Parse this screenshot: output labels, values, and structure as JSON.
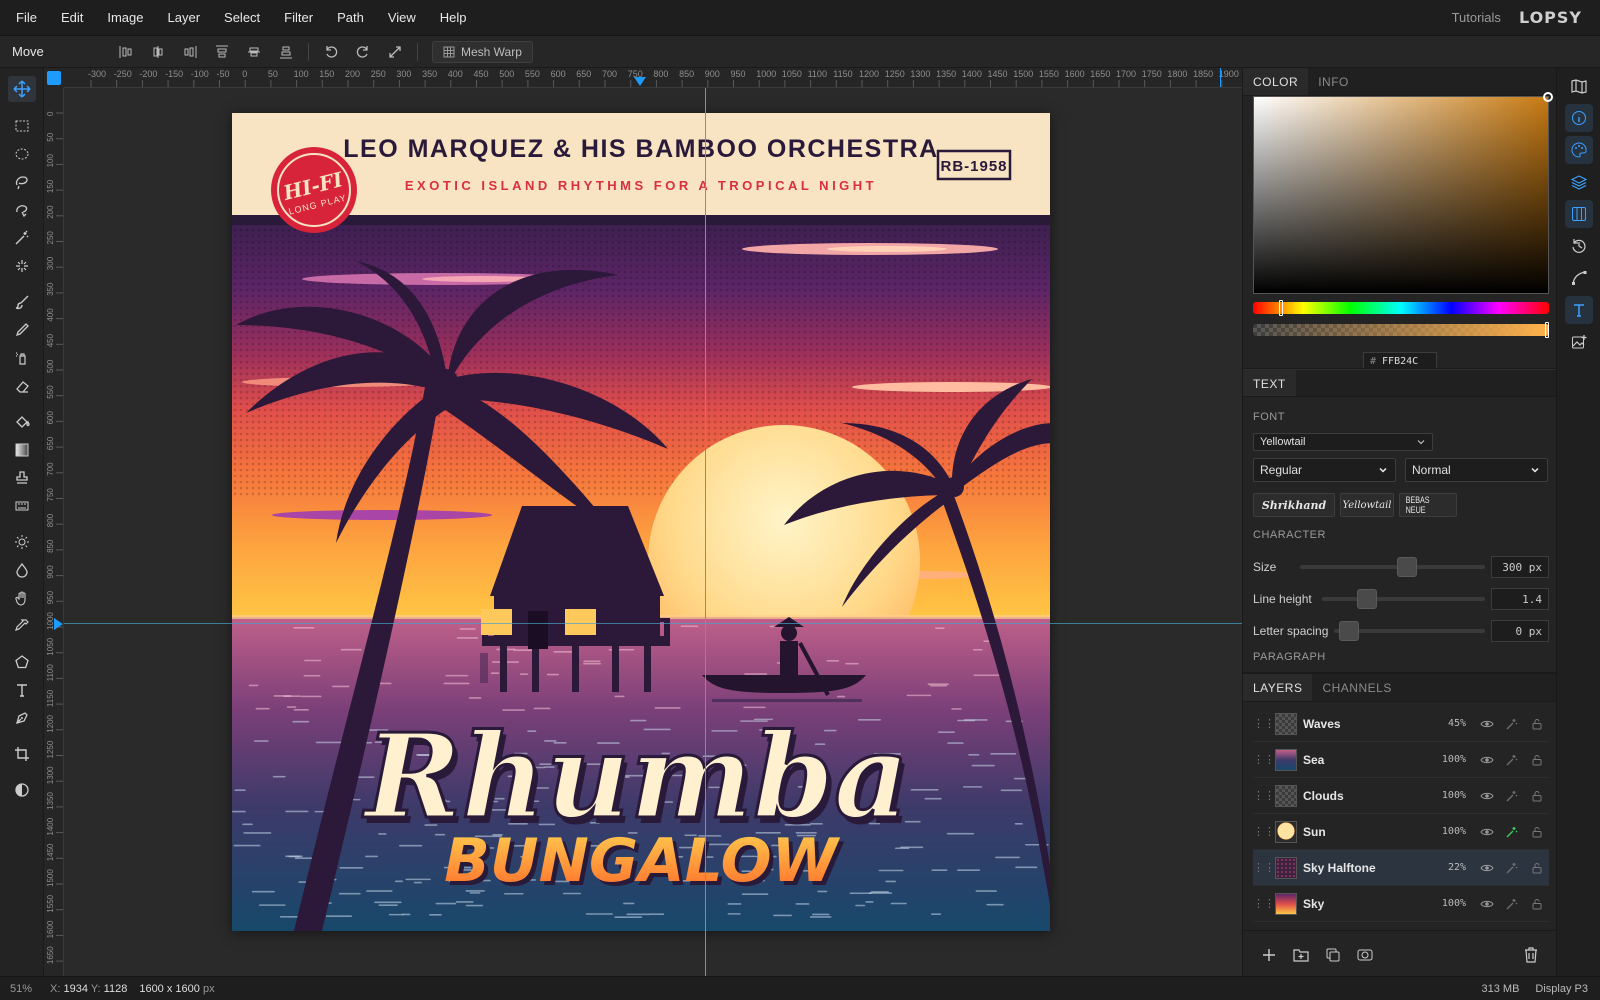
{
  "menu": [
    "File",
    "Edit",
    "Image",
    "Layer",
    "Select",
    "Filter",
    "Path",
    "View",
    "Help"
  ],
  "menubar_right": {
    "tutorials": "Tutorials",
    "brand": "LOPSY"
  },
  "options": {
    "tool_name": "Move",
    "mesh_warp": "Mesh Warp"
  },
  "ruler": {
    "h_ticks": [
      "-300",
      "-250",
      "-200",
      "-150",
      "-100",
      "-50",
      "0",
      "50",
      "100",
      "150",
      "200",
      "250",
      "300",
      "350",
      "400",
      "450",
      "500",
      "550",
      "600",
      "650",
      "700",
      "750",
      "800",
      "850",
      "900",
      "950",
      "1000",
      "1050",
      "1100",
      "1150",
      "1200",
      "1250",
      "1300",
      "1350",
      "1400",
      "1450",
      "1500",
      "1550",
      "1600",
      "1650",
      "1700",
      "1750",
      "1800",
      "1850",
      "1900",
      "19"
    ],
    "v_ticks": [
      "0",
      "50",
      "100",
      "150",
      "200",
      "250",
      "300",
      "350",
      "400",
      "450",
      "500",
      "550",
      "600",
      "650",
      "700",
      "750",
      "800",
      "850",
      "900",
      "950",
      "1000",
      "1050",
      "1100",
      "1150",
      "1200",
      "1250",
      "1300",
      "1350",
      "1400",
      "1450",
      "1500",
      "1550",
      "1600",
      "1650"
    ]
  },
  "artwork": {
    "band": "LEO MARQUEZ & HIS BAMBOO ORCHESTRA",
    "subtitle": "EXOTIC ISLAND RHYTHMS FOR A TROPICAL NIGHT",
    "catalog": "RB-1958",
    "badge_line1": "HI-FI",
    "badge_line2": "LONG PLAY",
    "title_script": "Rhumba",
    "title_block": "BUNGALOW"
  },
  "color_panel": {
    "tab_color": "COLOR",
    "tab_info": "INFO",
    "hex_prefix": "#",
    "hex": "FFB24C",
    "accent": "#FFB24C"
  },
  "text_panel": {
    "tab": "TEXT",
    "font_label": "FONT",
    "font": "Yellowtail",
    "weight": "Regular",
    "style": "Normal",
    "presets": [
      "Shrikhand",
      "Yellowtail",
      "BEBAS NEUE"
    ],
    "character_label": "CHARACTER",
    "size_label": "Size",
    "size_value": "300 px",
    "size_level": 0.58,
    "line_height_label": "Line height",
    "line_height_value": "1.4",
    "line_height_level": 0.28,
    "letter_spacing_label": "Letter spacing",
    "letter_spacing_value": "0 px",
    "letter_spacing_level": 0.1,
    "paragraph_label": "PARAGRAPH"
  },
  "layers_panel": {
    "tab_layers": "LAYERS",
    "tab_channels": "CHANNELS",
    "layers": [
      {
        "name": "Waves",
        "opacity": "45%",
        "thumb": "checker"
      },
      {
        "name": "Sea",
        "opacity": "100%",
        "thumb": "sea"
      },
      {
        "name": "Clouds",
        "opacity": "100%",
        "thumb": "checker"
      },
      {
        "name": "Sun",
        "opacity": "100%",
        "thumb": "sun"
      },
      {
        "name": "Sky Halftone",
        "opacity": "22%",
        "thumb": "halftone",
        "selected": true
      },
      {
        "name": "Sky",
        "opacity": "100%",
        "thumb": "sky"
      }
    ]
  },
  "status": {
    "zoom": "51%",
    "x_label": "X:",
    "x": "1934",
    "y_label": "Y:",
    "y": "1128",
    "dims": "1600 x 1600",
    "unit": "px",
    "memory": "313 MB",
    "display": "Display P3"
  },
  "colors": {
    "accent_blue": "#1e9bff",
    "guide": "#46a2c8",
    "sun_fx": "#3ecf5a"
  }
}
